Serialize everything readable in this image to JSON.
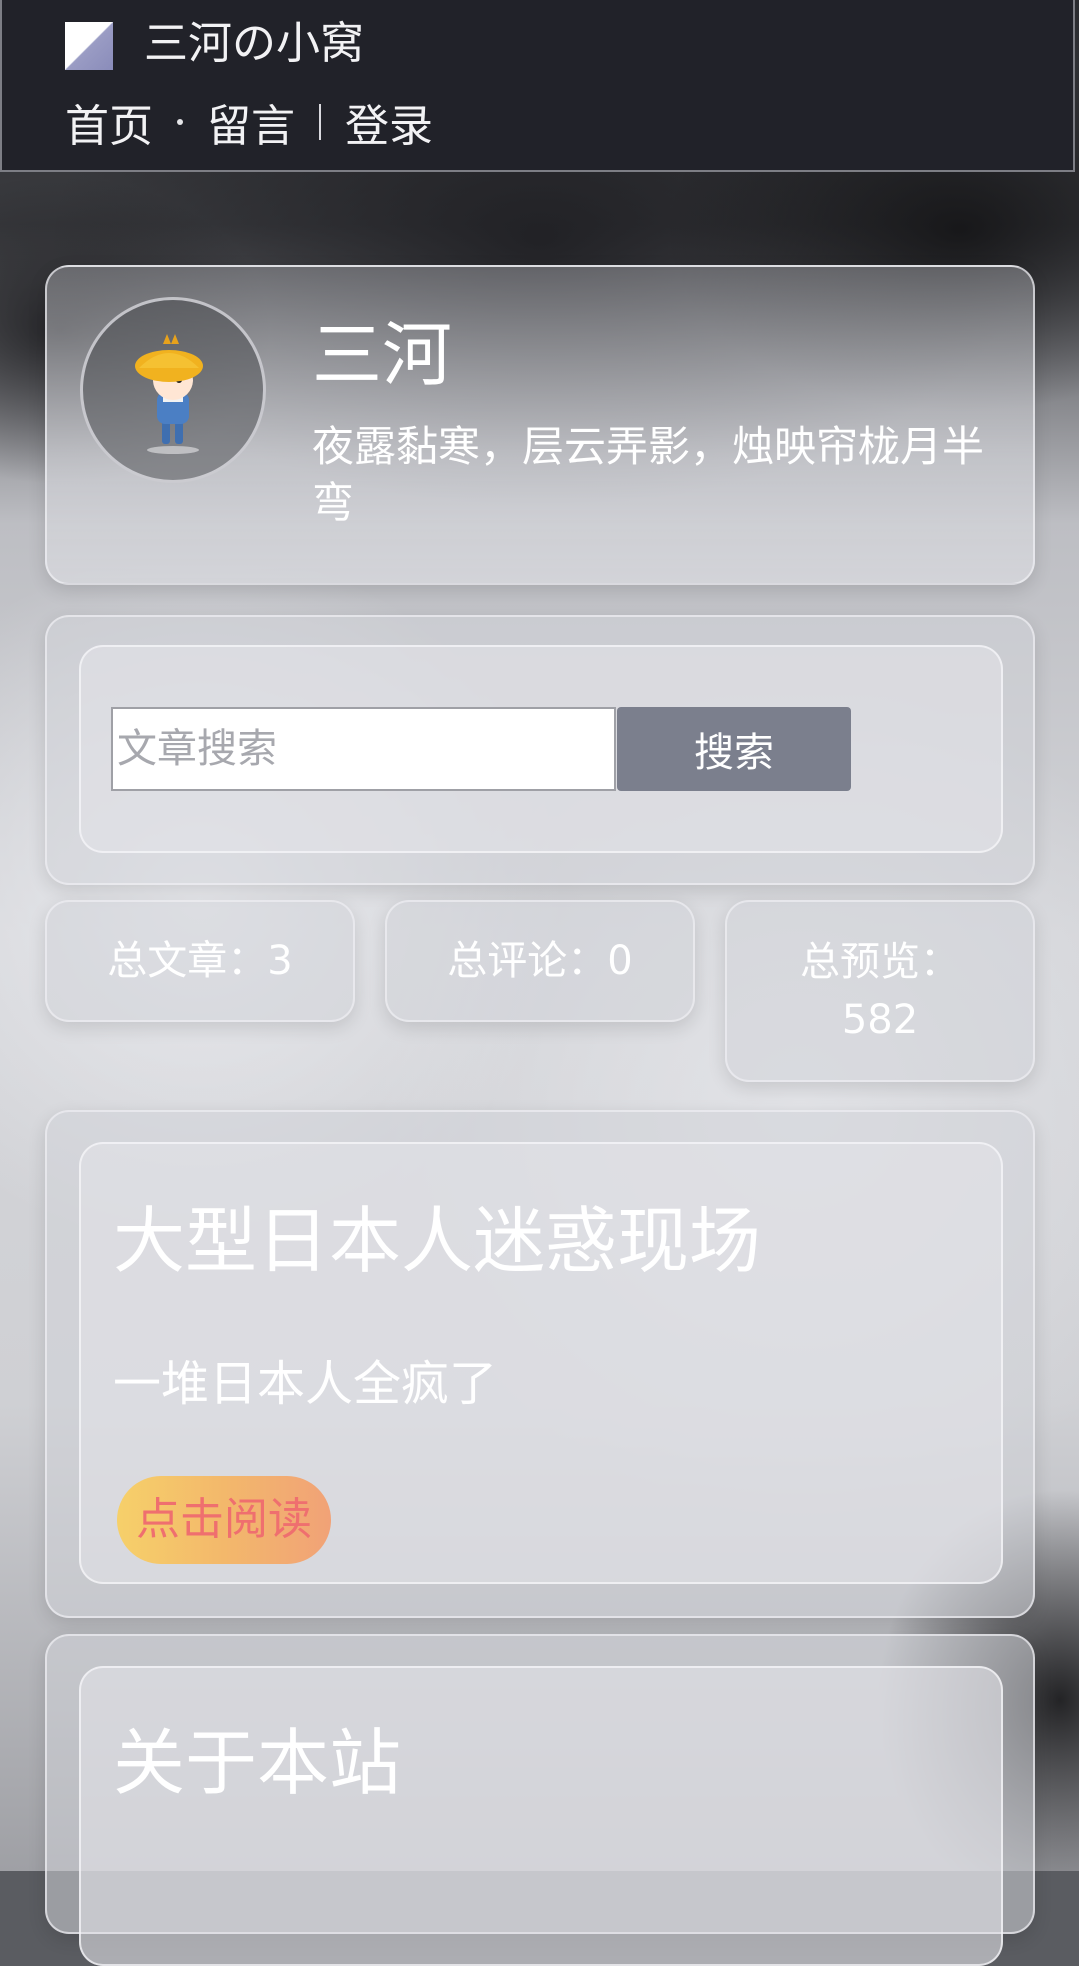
{
  "header": {
    "site_title": "三河の小窝",
    "nav": {
      "home": "首页",
      "guestbook": "留言",
      "login": "登录"
    }
  },
  "profile": {
    "name": "三河",
    "motto": "夜露黏寒，层云弄影，烛映帘栊月半弯"
  },
  "search": {
    "placeholder": "文章搜索",
    "button_label": "搜索"
  },
  "stats": {
    "articles": "总文章：3",
    "comments": "总评论：0",
    "views": "总预览：582"
  },
  "article": {
    "title": "大型日本人迷惑现场",
    "summary": "一堆日本人全疯了",
    "read_label": "点击阅读"
  },
  "about": {
    "title": "关于本站"
  }
}
